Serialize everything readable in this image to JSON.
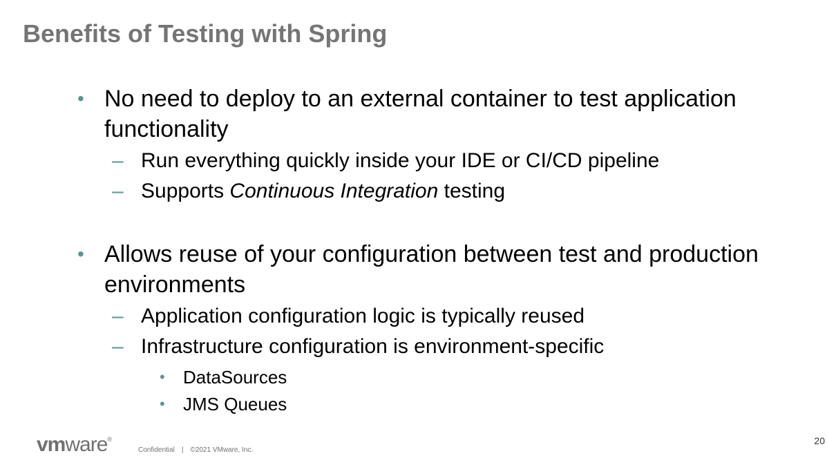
{
  "slide": {
    "title": "Benefits of Testing with Spring",
    "page_number": "20"
  },
  "bullets": [
    {
      "text": "No need to deploy to an external container to test application functionality",
      "sub": [
        {
          "text": "Run everything quickly inside your IDE or CI/CD pipeline"
        },
        {
          "prefix": "Supports ",
          "emphasis": "Continuous Integration",
          "suffix": " testing"
        }
      ]
    },
    {
      "text": "Allows reuse of your configuration between test and production environments",
      "sub": [
        {
          "text": "Application configuration logic is typically reused"
        },
        {
          "text": "Infrastructure configuration is environment-specific",
          "sub": [
            "DataSources",
            "JMS Queues"
          ]
        }
      ]
    }
  ],
  "footer": {
    "logo_bold": "vm",
    "logo_light": "ware",
    "logo_mark": "®",
    "confidential": "Confidential",
    "separator": "|",
    "copyright": "©2021 VMware, Inc."
  },
  "colors": {
    "title": "#757575",
    "bullet_marker": "#5a9690",
    "text": "#000000"
  }
}
